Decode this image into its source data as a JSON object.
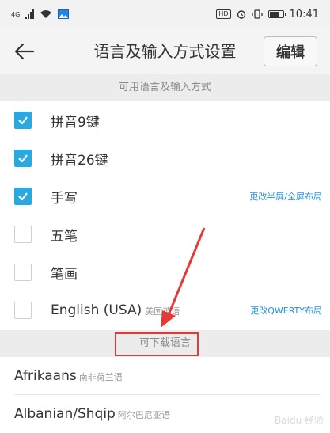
{
  "status_bar": {
    "time": "10:41",
    "hd_badge": "HD",
    "network_label": "4G"
  },
  "header": {
    "title": "语言及输入方式设置",
    "edit_label": "编辑"
  },
  "available_section": {
    "title": "可用语言及输入方式",
    "items": [
      {
        "label": "拼音9键",
        "sub": "",
        "checked": true,
        "link": ""
      },
      {
        "label": "拼音26键",
        "sub": "",
        "checked": true,
        "link": ""
      },
      {
        "label": "手写",
        "sub": "",
        "checked": true,
        "link": "更改半屏/全屏布局"
      },
      {
        "label": "五笔",
        "sub": "",
        "checked": false,
        "link": ""
      },
      {
        "label": "笔画",
        "sub": "",
        "checked": false,
        "link": ""
      },
      {
        "label": "English (USA)",
        "sub": "美国英语",
        "checked": false,
        "link": "更改QWERTY布局"
      }
    ]
  },
  "download_section": {
    "title": "可下载语言",
    "items": [
      {
        "label": "Afrikaans",
        "sub": "南非荷兰语"
      },
      {
        "label": "Albanian/Shqip",
        "sub": "阿尔巴尼亚语"
      }
    ]
  },
  "watermark": "Baidu 经验",
  "colors": {
    "accent": "#29a9e0",
    "link": "#2b8fd6",
    "annotation": "#e53935"
  }
}
